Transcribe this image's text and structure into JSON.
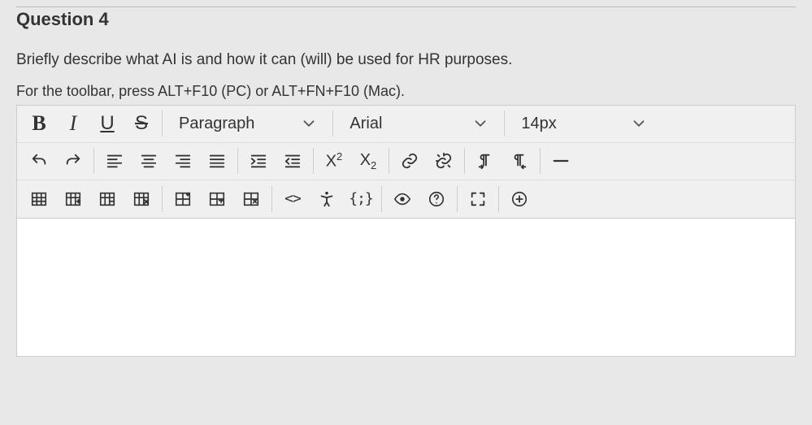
{
  "question": {
    "title": "Question 4",
    "prompt": "Briefly describe what AI is and how it can (will) be used for HR purposes.",
    "toolbar_hint": "For the toolbar, press ALT+F10 (PC) or ALT+FN+F10 (Mac)."
  },
  "toolbar": {
    "bold": "B",
    "italic": "I",
    "underline": "U",
    "strike": "S",
    "block_format": "Paragraph",
    "font_family": "Arial",
    "font_size": "14px",
    "superscript": "X",
    "subscript": "X",
    "codesample": "<>",
    "braces": "{;}"
  }
}
